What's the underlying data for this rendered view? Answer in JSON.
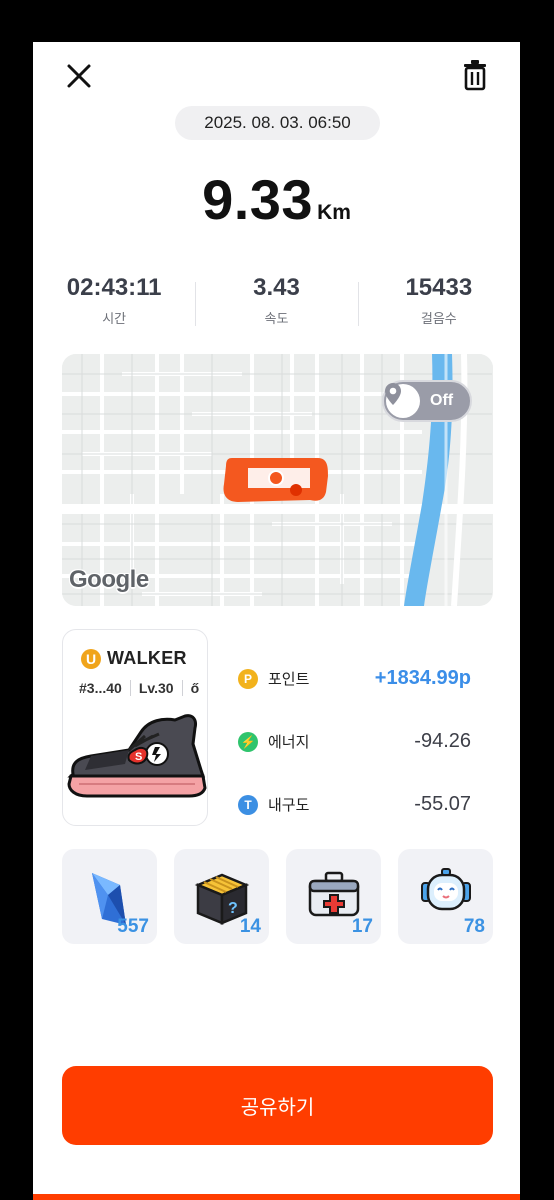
{
  "header": {
    "close_icon": "close-icon",
    "delete_icon": "trash-icon",
    "date": "2025. 08. 03. 06:50"
  },
  "distance": {
    "value": "9.33",
    "unit": "Km"
  },
  "stats": [
    {
      "value": "02:43:11",
      "label": "시간"
    },
    {
      "value": "3.43",
      "label": "속도"
    },
    {
      "value": "15433",
      "label": "걸음수"
    }
  ],
  "map": {
    "toggle_label": "Off",
    "toggle_icon": "location-pin-icon",
    "attribution": "Google"
  },
  "shoe": {
    "brand_initial": "U",
    "brand_name": "WALKER",
    "id": "#3...40",
    "level": "Lv.30",
    "extra": "ő"
  },
  "rewards": [
    {
      "icon_letter": "P",
      "label": "포인트",
      "value": "+1834.99p",
      "color": "#f2b21c"
    },
    {
      "icon_letter": "⚡",
      "label": "에너지",
      "value": "-94.26",
      "color": "#2fc46d"
    },
    {
      "icon_letter": "T",
      "label": "내구도",
      "value": "-55.07",
      "color": "#3c8fe3"
    }
  ],
  "items": [
    {
      "name": "gem",
      "count": "557"
    },
    {
      "name": "mystery-box",
      "count": "14"
    },
    {
      "name": "repair-kit",
      "count": "17"
    },
    {
      "name": "robot",
      "count": "78"
    }
  ],
  "share_label": "공유하기",
  "colors": {
    "accent": "#ff3d00",
    "points_blue": "#3b8ee8",
    "item_count_blue": "#3b92e3"
  }
}
